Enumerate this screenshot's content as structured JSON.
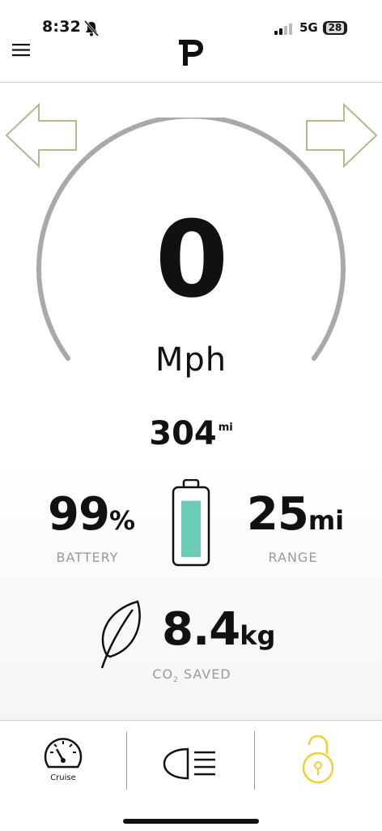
{
  "status_bar": {
    "time": "8:32",
    "network": "5G",
    "battery_level": "28"
  },
  "header": {
    "logo_letter": "P"
  },
  "speedometer": {
    "speed": "0",
    "unit": "Mph"
  },
  "odometer": {
    "value": "304",
    "unit": "mi"
  },
  "battery": {
    "value": "99",
    "unit": "%",
    "label": "BATTERY",
    "fill_fraction": 0.99
  },
  "range": {
    "value": "25",
    "unit": "mi",
    "label": "RANGE"
  },
  "co2": {
    "value": "8.4",
    "unit": "kg",
    "label_prefix": "CO",
    "label_sub": "2",
    "label_suffix": " SAVED"
  },
  "bottom_bar": {
    "cruise_label": "Cruise"
  },
  "colors": {
    "arrow": "#a7c08c",
    "gauge": "#a9a9a9",
    "battery_fill": "#6ccbb6",
    "lock": "#f1cf3a"
  },
  "icons": [
    "bell-mute-icon",
    "signal-icon",
    "menu-icon",
    "arrow-left-icon",
    "arrow-right-icon",
    "battery-icon",
    "leaf-icon",
    "speedometer-icon",
    "headlight-icon",
    "unlock-icon"
  ]
}
